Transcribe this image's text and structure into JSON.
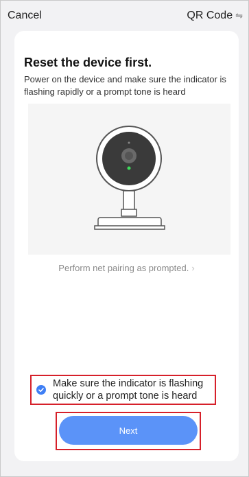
{
  "header": {
    "cancel_label": "Cancel",
    "qr_label": "QR Code",
    "qr_icon": "⇋"
  },
  "card": {
    "title": "Reset the device first.",
    "description": "Power on the device and make sure the indicator is flashing rapidly or a prompt tone is heard",
    "illustration": "camera-illustration",
    "pairing_link": "Perform net pairing as prompted.",
    "pairing_chevron": "›",
    "confirm_text": "Make sure the indicator is flashing quickly or a prompt tone is heard",
    "confirm_checked": true,
    "next_label": "Next"
  },
  "colors": {
    "accent": "#5b93f8",
    "check": "#3f7ff5",
    "highlight": "#d6202a",
    "led": "#3ddc5a"
  }
}
